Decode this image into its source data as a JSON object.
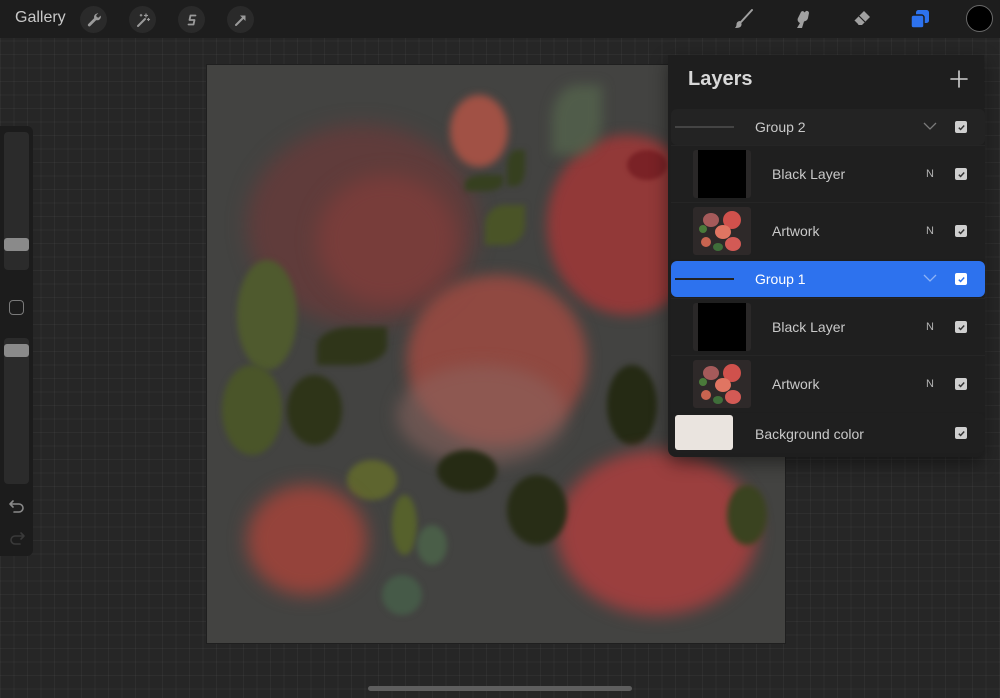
{
  "toolbar": {
    "gallery_label": "Gallery",
    "left_tools": [
      {
        "name": "actions",
        "icon": "wrench-icon"
      },
      {
        "name": "adjustments",
        "icon": "magic-wand-icon"
      },
      {
        "name": "selection",
        "icon": "selection-s-icon"
      },
      {
        "name": "transform",
        "icon": "arrow-cursor-icon"
      }
    ],
    "right_tools": [
      {
        "name": "brush",
        "icon": "paintbrush-icon",
        "active": false
      },
      {
        "name": "smudge",
        "icon": "smudge-finger-icon",
        "active": false
      },
      {
        "name": "eraser",
        "icon": "eraser-icon",
        "active": false
      },
      {
        "name": "layers",
        "icon": "layers-icon",
        "active": true
      }
    ],
    "current_color": "#000000",
    "accent_color": "#2d72ee"
  },
  "sidebar": {
    "brush_size_fraction": 0.15,
    "opacity_fraction": 0.97,
    "modify_button": "square-icon",
    "undo": "undo-icon",
    "redo": "redo-icon"
  },
  "layers_panel": {
    "title": "Layers",
    "add_button": "plus-icon",
    "rows": [
      {
        "type": "group",
        "label": "Group 2",
        "expanded": true,
        "visible": true,
        "selected": false
      },
      {
        "type": "layer",
        "label": "Black Layer",
        "thumbnail": "black",
        "blend": "N",
        "visible": true
      },
      {
        "type": "layer",
        "label": "Artwork",
        "thumbnail": "floral-artwork",
        "blend": "N",
        "visible": true
      },
      {
        "type": "group",
        "label": "Group 1",
        "expanded": true,
        "visible": true,
        "selected": true
      },
      {
        "type": "layer",
        "label": "Black Layer",
        "thumbnail": "black",
        "blend": "N",
        "visible": true
      },
      {
        "type": "layer",
        "label": "Artwork",
        "thumbnail": "floral-artwork",
        "blend": "N",
        "visible": true
      },
      {
        "type": "background",
        "label": "Background color",
        "color": "#eae4df",
        "visible": true
      }
    ]
  }
}
